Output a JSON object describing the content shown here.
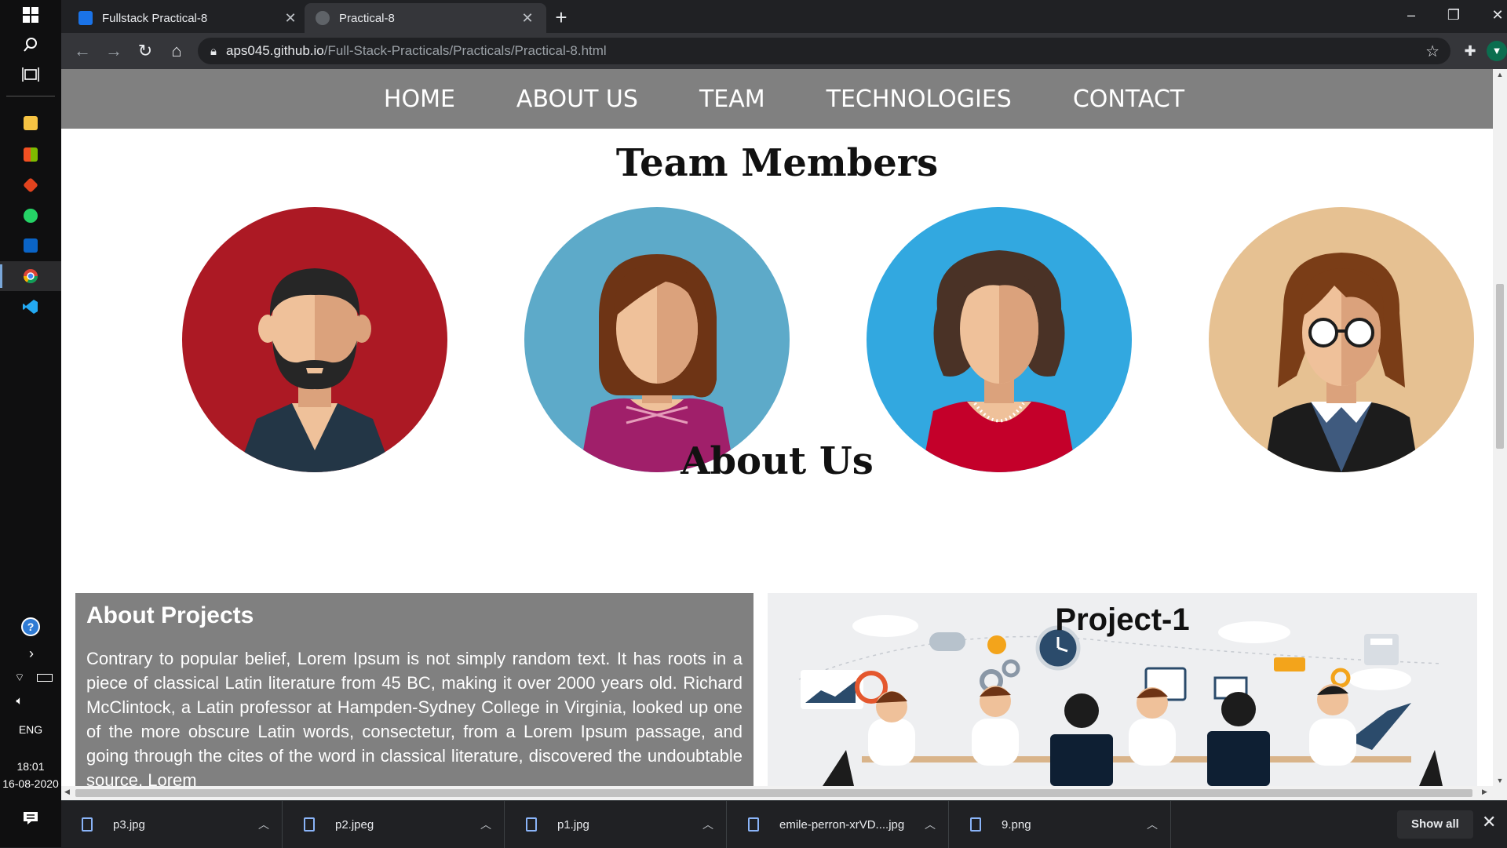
{
  "taskbar": {
    "icons": [
      "windows-start-icon",
      "search-icon",
      "task-view-icon",
      "file-explorer-icon",
      "store-icon",
      "office-icon",
      "whatsapp-icon",
      "outlook-icon",
      "chrome-icon",
      "vscode-icon"
    ],
    "language": "ENG",
    "time": "18:01",
    "date": "16-08-2020"
  },
  "browser": {
    "tabs": [
      {
        "title": "Fullstack Practical-8",
        "active": false
      },
      {
        "title": "Practical-8",
        "active": true
      }
    ],
    "url_host": "aps045.github.io",
    "url_path": "/Full-Stack-Practicals/Practicals/Practical-8.html"
  },
  "site": {
    "nav": [
      "HOME",
      "ABOUT US",
      "TEAM",
      "TECHNOLOGIES",
      "CONTACT"
    ],
    "team_title": "Team Members",
    "team": [
      {
        "icon": "bearded-man-avatar-icon",
        "bg": "#ac1924"
      },
      {
        "icon": "woman-brown-hair-avatar-icon",
        "bg": "#5daac9"
      },
      {
        "icon": "woman-curly-hair-avatar-icon",
        "bg": "#32a8e0"
      },
      {
        "icon": "glasses-person-avatar-icon",
        "bg": "#e6c192"
      }
    ],
    "about_title": "About Us",
    "about_projects": {
      "heading": "About Projects",
      "text": "Contrary to popular belief, Lorem Ipsum is not simply random text. It has roots in a piece of classical Latin literature from 45 BC, making it over 2000 years old. Richard McClintock, a Latin professor at Hampden-Sydney College in Virginia, looked up one of the more obscure Latin words, consectetur, from a Lorem Ipsum passage, and going through the cites of the word in classical literature, discovered the undoubtable source. Lorem"
    },
    "project": {
      "heading": "Project-1"
    }
  },
  "downloads": [
    {
      "name": "p3.jpg"
    },
    {
      "name": "p2.jpeg"
    },
    {
      "name": "p1.jpg"
    },
    {
      "name": "emile-perron-xrVD....jpg"
    },
    {
      "name": "9.png"
    }
  ],
  "downloads_show_all": "Show all"
}
